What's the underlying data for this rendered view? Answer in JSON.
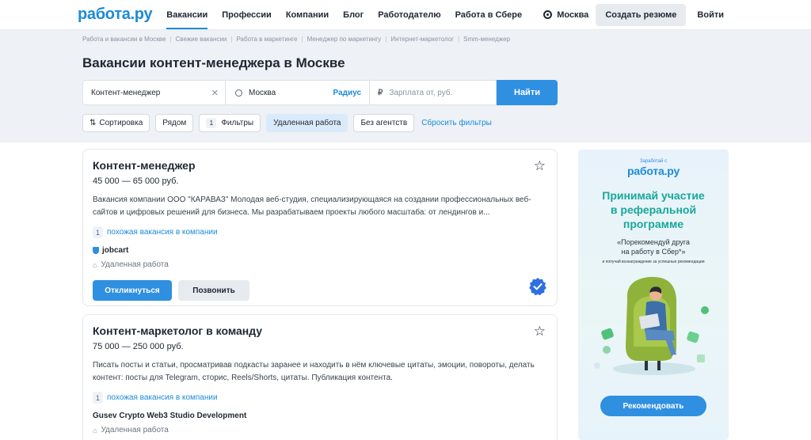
{
  "header": {
    "logo": "работа.ру",
    "nav": [
      {
        "label": "Вакансии",
        "active": true
      },
      {
        "label": "Профессии",
        "active": false
      },
      {
        "label": "Компании",
        "active": false
      },
      {
        "label": "Блог",
        "active": false
      },
      {
        "label": "Работодателю",
        "active": false
      },
      {
        "label": "Работа в Сбере",
        "active": false
      }
    ],
    "city": "Москва",
    "create_resume": "Создать резюме",
    "login": "Войти"
  },
  "breadcrumbs": [
    "Работа и вакансии в Москве",
    "Свежие вакансии",
    "Работа в маркетинге",
    "Менеджер по маркетингу",
    "Интернет-маркетолог",
    "Smm-менеджер"
  ],
  "page_title": "Вакансии контент-менеджера в Москве",
  "search": {
    "query": "Контент-менеджер",
    "city": "Москва",
    "radius": "Радиус",
    "salary_placeholder": "Зарплата от, руб.",
    "currency": "₽",
    "find": "Найти"
  },
  "filters": {
    "sort": "Сортировка",
    "nearby": "Рядом",
    "filters_count": "1",
    "filters_label": "Фильтры",
    "remote": "Удаленная работа",
    "no_agencies": "Без агентств",
    "reset": "Сбросить фильтры"
  },
  "vacancies": [
    {
      "title": "Контент-менеджер",
      "salary": "45 000 — 65 000 руб.",
      "description": "Вакансия компании ООО \"КАРАВАЗ\" Молодая веб-студия, специализирующаяся на создании профессиональных веб-сайтов и цифровых решений для бизнеса. Мы разрабатываем проекты любого масштаба: от лендингов и...",
      "similar_count": "1",
      "similar_label": "похожая вакансия в компании",
      "company": "jobcart",
      "work_type": "Удаленная работа",
      "apply": "Откликнуться",
      "call": "Позвонить"
    },
    {
      "title": "Контент-маркетолог в команду",
      "salary": "75 000 — 250 000 руб.",
      "description": "Писать посты и статьи, просматривав подкасты заранее и находить в нём ключевые цитаты, эмоции, повороты, делать контент: посты для Telegram, сторис, Reels/Shorts, цитаты. Публикация контента.",
      "similar_count": "1",
      "similar_label": "похожая вакансия в компании",
      "company": "Gusev Crypto Web3 Studio Development",
      "work_type": "Удаленная работа"
    }
  ],
  "banner": {
    "earn": "Заработай с",
    "logo": "работа.ру",
    "headline_1": "Принимай участие",
    "headline_2": "в реферальной",
    "headline_3": "программе",
    "quote_1": "«Порекомендуй друга",
    "quote_2": "на работу в Сбер*»",
    "small": "и получай вознаграждение за успешные рекомендации",
    "button": "Рекомендовать"
  },
  "colors": {
    "brand": "#1b8bd8",
    "primary_button": "#2f8fe0",
    "hero_bg": "#eef1f5",
    "banner_headline": "#17a89a"
  }
}
